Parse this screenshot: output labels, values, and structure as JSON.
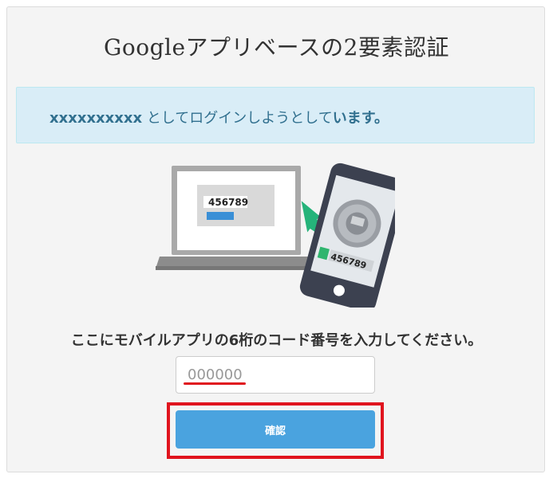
{
  "page": {
    "title": "Googleアプリベースの2要素認証"
  },
  "info_alert": {
    "username": "xxxxxxxxxx",
    "middle_text": " としてログインしようとして",
    "end_text": "います。"
  },
  "illustration": {
    "laptop_code": "456789",
    "phone_code": "456789"
  },
  "form": {
    "prompt": "ここにモバイルアプリの6桁のコード番号を入力してください。",
    "code_placeholder": "000000",
    "confirm_label": "確認"
  },
  "colors": {
    "alert_bg": "#d9edf7",
    "alert_text": "#31708f",
    "button": "#4aa3df",
    "highlight_red": "#e0141e",
    "arrow_green": "#25b37a"
  }
}
